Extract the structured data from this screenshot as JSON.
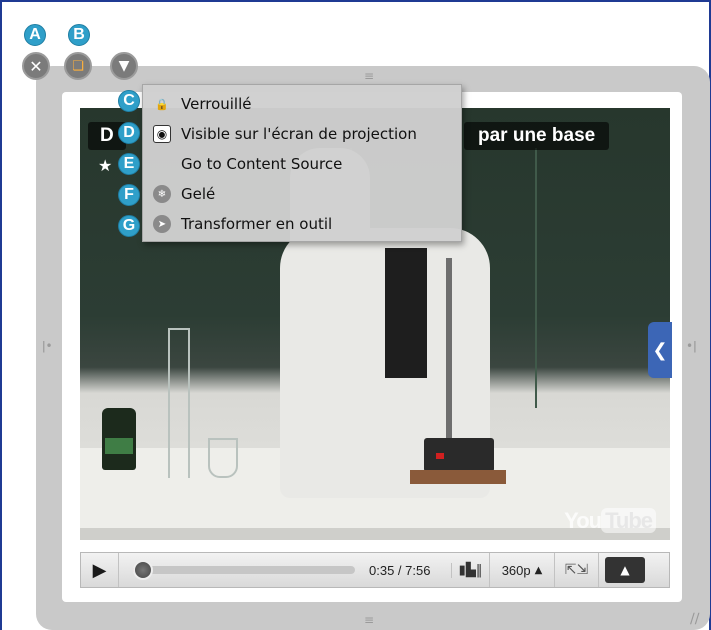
{
  "callouts": {
    "a": "A",
    "b": "B",
    "c": "C",
    "d": "D",
    "e": "E",
    "f": "F",
    "g": "G"
  },
  "video": {
    "title_left": "D",
    "title_right": "par une base",
    "star": "★",
    "youtube_logo": {
      "you": "You",
      "tube": "Tube"
    }
  },
  "player": {
    "time": "0:35 / 7:56",
    "quality": "360p",
    "played_fraction": 0.074
  },
  "context_menu": {
    "items": [
      {
        "label": "Verrouillé",
        "icon": "lock-icon"
      },
      {
        "label": "Visible sur l'écran de projection",
        "icon": "eye-icon"
      },
      {
        "label": "Go to Content Source",
        "icon": ""
      },
      {
        "label": "Gelé",
        "icon": "snowflake-icon"
      },
      {
        "label": "Transformer en outil",
        "icon": "tool-icon"
      }
    ]
  },
  "colors": {
    "callout": "#2f9fc9",
    "frame": "#c9c9c9",
    "border": "#1f3a93",
    "accent": "#3c66b6",
    "progress": "#d9212b"
  }
}
